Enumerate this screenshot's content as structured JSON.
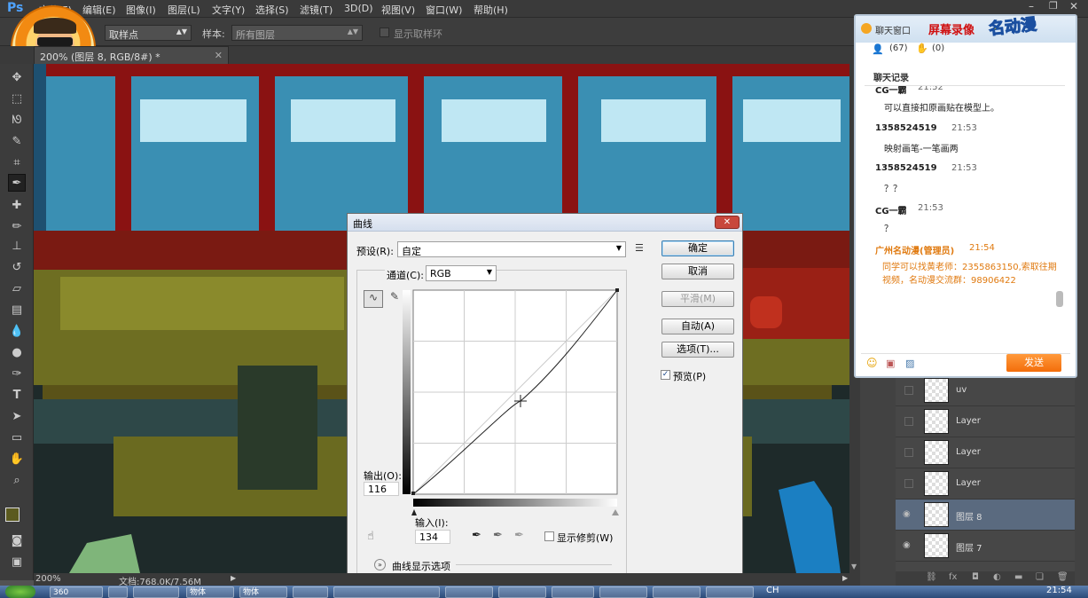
{
  "app": {
    "logo": "Ps"
  },
  "menu": [
    "文件(F)",
    "编辑(E)",
    "图像(I)",
    "图层(L)",
    "文字(Y)",
    "选择(S)",
    "滤镜(T)",
    "3D(D)",
    "视图(V)",
    "窗口(W)",
    "帮助(H)"
  ],
  "options": {
    "sample_size_label": "取样点",
    "sample_label": "样本:",
    "sample_value": "所有图层",
    "show_ring_label": "显示取样环"
  },
  "document": {
    "tab_title": "200% (图层 8, RGB/8#) *",
    "zoom": "200%",
    "doc_info": "文档:768.0K/7.56M"
  },
  "curves": {
    "title": "曲线",
    "preset_label": "预设(R):",
    "preset_value": "自定",
    "channel_label": "通道(C):",
    "channel_value": "RGB",
    "output_label": "输出(O):",
    "output_value": "116",
    "input_label": "输入(I):",
    "input_value": "134",
    "show_clipping_label": "显示修剪(W)",
    "display_options_label": "曲线显示选项",
    "ok_label": "确定",
    "cancel_label": "取消",
    "smooth_label": "平滑(M)",
    "auto_label": "自动(A)",
    "options_label": "选项(T)...",
    "preview_label": "预览(P)",
    "preview_checked": true
  },
  "chat": {
    "window_title": "聊天窗口",
    "brand_text": "屏幕录像",
    "logo_text": "名动漫",
    "members_count": "(67)",
    "hands_count": "(0)",
    "history_label": "聊天记录",
    "messages": [
      {
        "name": "CG一霸",
        "time": "21:52",
        "text": "可以直接扣原画贴在模型上。"
      },
      {
        "name": "1358524519",
        "time": "21:53",
        "text": "映射画笔-一笔画两"
      },
      {
        "name": "1358524519",
        "time": "21:53",
        "text": "？？"
      },
      {
        "name": "CG一霸",
        "time": "21:53",
        "text": "？"
      },
      {
        "name": "广州名动漫(管理员)",
        "time": "21:54",
        "text": "同学可以找黄老师：2355863150,索取往期视频，名动漫交流群：98906422",
        "admin": true
      }
    ],
    "send_label": "发送"
  },
  "layers": [
    {
      "name": "uv",
      "visible": false
    },
    {
      "name": "Layer",
      "visible": false
    },
    {
      "name": "Layer",
      "visible": false
    },
    {
      "name": "Layer",
      "visible": false
    },
    {
      "name": "图层 8",
      "visible": true,
      "selected": true
    },
    {
      "name": "图层 7",
      "visible": true
    }
  ],
  "taskbar": {
    "items": [
      "360",
      "",
      "",
      "",
      "",
      "物体",
      "物体",
      "",
      "",
      "",
      "",
      "",
      "",
      "",
      "",
      "",
      ""
    ],
    "ime": "CH",
    "clock": "21:54"
  },
  "colors": {
    "fg_swatch": "#5b5a1f",
    "bg_swatch": "#ffffff"
  }
}
